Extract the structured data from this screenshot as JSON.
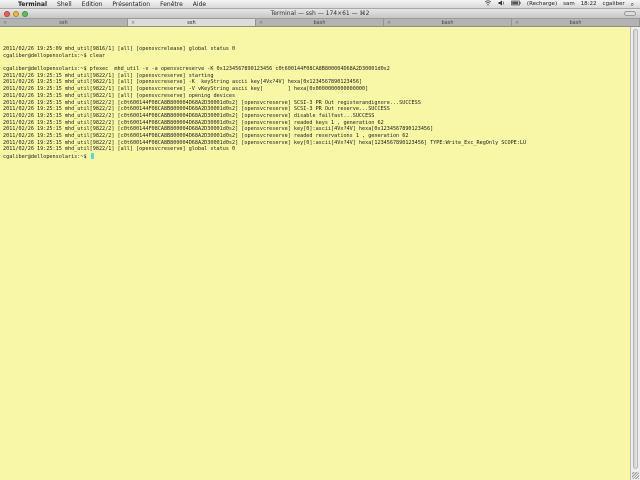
{
  "menubar": {
    "apple_glyph": "",
    "items": [
      "Terminal",
      "Shell",
      "Edition",
      "Présentation",
      "Fenêtre",
      "Aide"
    ],
    "status": {
      "battery_text": "(Recharge)",
      "user_icon_text": "sam",
      "clock": "18:22",
      "username": "cgaliber",
      "search_glyph": "⌕"
    }
  },
  "window": {
    "title": "Terminal — ssh — 174×61 — ⌘2"
  },
  "tabs": [
    {
      "label": "ssh",
      "active": false
    },
    {
      "label": "ssh",
      "active": true
    },
    {
      "label": "bash",
      "active": false
    },
    {
      "label": "bash",
      "active": false
    },
    {
      "label": "bash",
      "active": false
    }
  ],
  "terminal": {
    "lines": [
      "2011/02/26 19:25:09 mhd_util[9816/1] [all] [opensvcrelease] global status 0",
      "cgaliber@dellopensolaris:~$ clear",
      "",
      "cgaliber@dellopensolaris:~$ pfexec  mhd_util -v -a opensvcreserve -K 0x1234567890123456 c0t600144F08CA8B800004D68A2D30001d0s2",
      "2011/02/26 19:25:15 mhd_util[9822/1] [all] [opensvcreserve] starting",
      "2011/02/26 19:25:15 mhd_util[9822/1] [all] [opensvcreserve] -K  keyString ascii key[4Vx?4V] hexa[0x1234567890123456]",
      "2011/02/26 19:25:15 mhd_util[9822/1] [all] [opensvcreserve] -V vKeyString ascii key[        ] hexa[0x0000000000000000]",
      "2011/02/26 19:25:15 mhd_util[9822/1] [all] [opensvcreserve] opening devices",
      "2011/02/26 19:25:15 mhd_util[9822/2] [c0t600144F08CA8B800004D68A2D30001d0s2] [opensvcreserve] SCSI-3 PR Out registerandignore...SUCCESS",
      "2011/02/26 19:25:15 mhd_util[9822/2] [c0t600144F08CA8B800004D68A2D30001d0s2] [opensvcreserve] SCSI-3 PR Out reserve...SUCCESS",
      "2011/02/26 19:25:15 mhd_util[9822/2] [c0t600144F08CA8B800004D68A2D30001d0s2] [opensvcreserve] disable failfast...SUCCESS",
      "2011/02/26 19:25:15 mhd_util[9822/2] [c0t600144F08CA8B800004D68A2D30001d0s2] [opensvcreserve] readed keys 1 , generation 62",
      "2011/02/26 19:25:15 mhd_util[9822/2] [c0t600144F08CA8B800004D68A2D30001d0s2] [opensvcreserve] key[0]:ascii[4Vx?4V] hexa[0x1234567890123456]",
      "2011/02/26 19:25:15 mhd_util[9822/2] [c0t600144F08CA8B800004D68A2D30001d0s2] [opensvcreserve] readed reservations 1 , generation 62",
      "2011/02/26 19:25:15 mhd_util[9822/2] [c0t600144F08CA8B800004D68A2D30001d0s2] [opensvcreserve] key[0]:ascii[4Vx?4V] hexa[1234567890123456] TYPE:Write_Exc_RegOnly SCOPE:LU",
      "2011/02/26 19:25:15 mhd_util[9822/1] [all] [opensvcreserve] global status 0"
    ],
    "prompt": "cgaliber@dellopensolaris:~$ ",
    "cursor_color": "#5ed3d8",
    "background_color": "#f8f7a6"
  }
}
